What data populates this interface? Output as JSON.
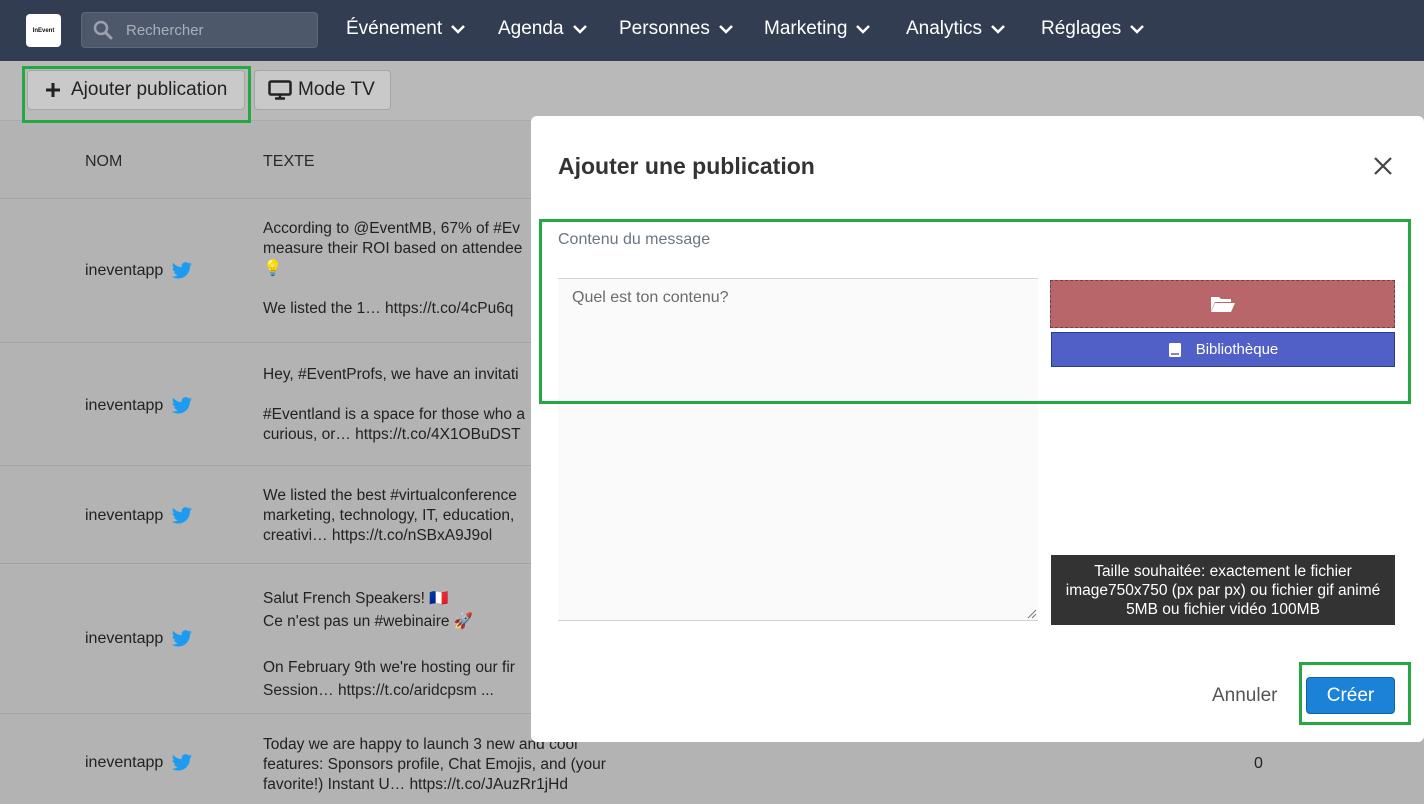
{
  "topbar": {
    "logo_text": "InEvent",
    "search_placeholder": "Rechercher",
    "nav": [
      "Événement",
      "Agenda",
      "Personnes",
      "Marketing",
      "Analytics",
      "Réglages"
    ]
  },
  "toolbar": {
    "add_label": "Ajouter publication",
    "tv_label": "Mode TV"
  },
  "table": {
    "headers": {
      "name": "NOM",
      "text": "TEXTE"
    },
    "rows": [
      {
        "name": "ineventapp",
        "text": "According to @EventMB, 67% of #Ev\nmeasure their ROI based on attendee\n💡\n\nWe listed the 1… https://t.co/4cPu6q"
      },
      {
        "name": "ineventapp",
        "text": "Hey, #EventProfs, we have an invitati\n\n#Eventland is a space for those who a\ncurious, or… https://t.co/4X1OBuDST"
      },
      {
        "name": "ineventapp",
        "text": "We listed the best #virtualconference\nmarketing, technology, IT, education,\ncreativi… https://t.co/nSBxA9J9ol"
      },
      {
        "name": "ineventapp",
        "text": "Salut French Speakers! 🇫🇷\nCe n'est pas un #webinaire 🚀\n\nOn February 9th we're hosting our fir\nSession… https://t.co/aridcpsm ..."
      },
      {
        "name": "ineventapp",
        "text": "Today we are happy to launch 3 new and cool\nfeatures: Sponsors profile, Chat Emojis, and (your\nfavorite!) Instant U… https://t.co/JAuzRr1jHd",
        "count": "0"
      }
    ]
  },
  "modal": {
    "title": "Ajouter une publication",
    "field_label": "Contenu du message",
    "placeholder": "Quel est ton contenu?",
    "library_label": "Bibliothèque",
    "hint": "Taille souhaitée: exactement le fichier image750x750 (px par px) ou fichier gif animé 5MB ou fichier vidéo 100MB",
    "cancel_label": "Annuler",
    "create_label": "Créer"
  },
  "colors": {
    "topbar": "#333d52",
    "highlight": "#27a644",
    "upload": "#b9666a",
    "library": "#5060c6",
    "primary": "#1b82d8",
    "twitter": "#1d9bf0"
  }
}
